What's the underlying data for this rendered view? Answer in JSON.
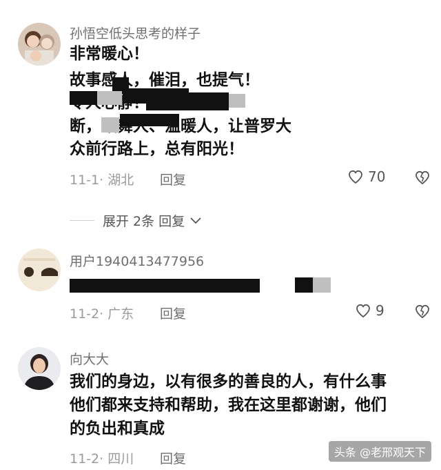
{
  "comments": [
    {
      "username": "孙悟空低头思考的样子",
      "lines": [
        "非常暖心！",
        "故事感人，催泪，也提气！",
        "                          令人心静！",
        "              断，鼓舞人、温暖人，让普罗大",
        "众前行路上，总有阳光！"
      ],
      "meta": "11-1· 湖北",
      "reply_label": "回复",
      "likes": "70"
    },
    {
      "username": "用户1940413477956",
      "lines": [
        ""
      ],
      "meta": "11-2· 广东",
      "reply_label": "回复",
      "likes": "9"
    },
    {
      "username": "向大大",
      "lines": [
        "我们的身边，以有很多的善良的人，有什么事",
        "他们都来支持和帮助，我在这里都谢谢，他们",
        "的负出和真成"
      ],
      "meta": "11-2· 四川",
      "reply_label": "回复"
    }
  ],
  "expand_replies": {
    "label": "展开 2条 回复"
  },
  "watermark": "头条 @老邢观天下",
  "colors": {
    "username": "#6f6f6f",
    "body_text": "#111111",
    "meta_text": "#9a9a9a",
    "redaction": "#111111"
  },
  "icons": {
    "like": "heart-outline-icon",
    "dislike": "broken-heart-icon",
    "expand": "chevron-down-icon"
  }
}
